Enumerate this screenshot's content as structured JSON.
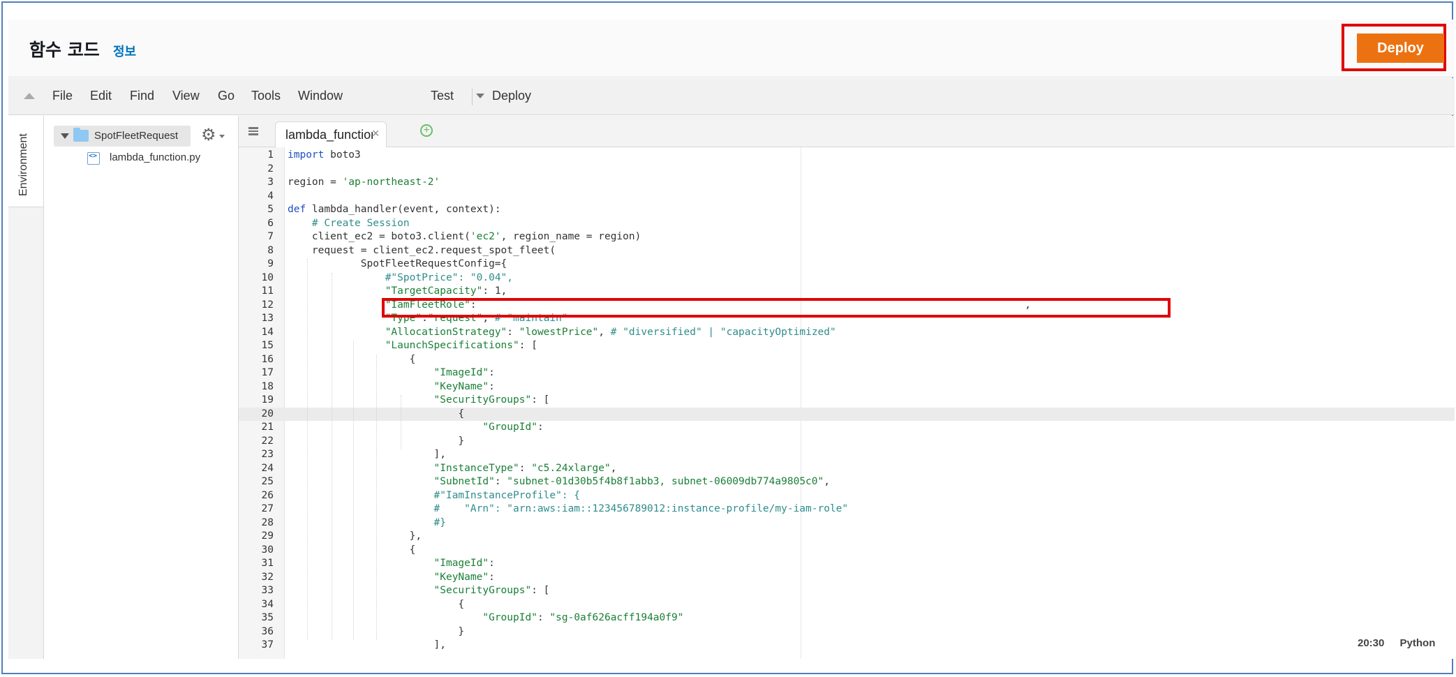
{
  "header": {
    "title": "함수 코드",
    "info_link": "정보",
    "deploy_label": "Deploy",
    "deploy_color": "#ec7211"
  },
  "menubar": {
    "collapse_icon": "triangle-up-icon",
    "items": [
      "File",
      "Edit",
      "Find",
      "View",
      "Go",
      "Tools",
      "Window"
    ],
    "test_label": "Test",
    "deploy_label": "Deploy"
  },
  "sidebar": {
    "environment_tab": "Environment",
    "folder_name": "SpotFleetRequest",
    "settings_icon": "gear-icon",
    "files": [
      "lambda_function.py"
    ]
  },
  "editor": {
    "tab_label": "lambda_function",
    "tab_close": "×",
    "add_tab_icon": "plus-circle-icon",
    "active_line": 20,
    "lines": [
      "import boto3",
      "",
      "region = 'ap-northeast-2'",
      "",
      "def lambda_handler(event, context):",
      "    # Create Session",
      "    client_ec2 = boto3.client('ec2', region_name = region)",
      "    request = client_ec2.request_spot_fleet(",
      "            SpotFleetRequestConfig={",
      "                #\"SpotPrice\": \"0.04\",",
      "                \"TargetCapacity\": 1,",
      "                \"IamFleetRole\":                                                                                          ,",
      "                \"Type\":\"request\", # \"maintain\"",
      "                \"AllocationStrategy\": \"lowestPrice\", # \"diversified\" | \"capacityOptimized\"",
      "                \"LaunchSpecifications\": [",
      "                    {",
      "                        \"ImageId\":",
      "                        \"KeyName\":",
      "                        \"SecurityGroups\": [",
      "                            {",
      "                                \"GroupId\":",
      "                            }",
      "                        ],",
      "                        \"InstanceType\": \"c5.24xlarge\",",
      "                        \"SubnetId\": \"subnet-01d30b5f4b8f1abb3, subnet-06009db774a9805c0\",",
      "                        #\"IamInstanceProfile\": {",
      "                        #    \"Arn\": \"arn:aws:iam::123456789012:instance-profile/my-iam-role\"",
      "                        #}",
      "                    },",
      "                    {",
      "                        \"ImageId\":",
      "                        \"KeyName\":",
      "                        \"SecurityGroups\": [",
      "                            {",
      "                                \"GroupId\": \"sg-0af626acff194a0f9\"",
      "                            }",
      "                        ],"
    ]
  },
  "status": {
    "cursor": "20:30",
    "language": "Python"
  }
}
